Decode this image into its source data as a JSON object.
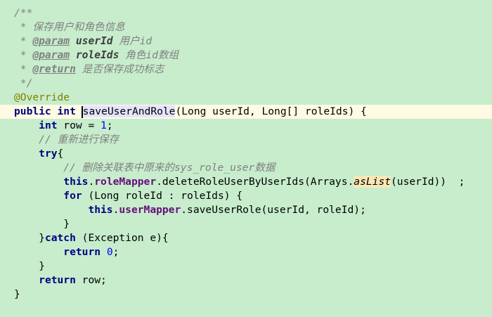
{
  "code": {
    "l1": "/**",
    "l2_prefix": " * ",
    "l2_text": "保存用户和角色信息",
    "l3_prefix": " * ",
    "l3_tag": "@param",
    "l3_name": "userId",
    "l3_desc": " 用户id",
    "l4_prefix": " * ",
    "l4_tag": "@param",
    "l4_name": "roleIds",
    "l4_desc": " 角色id数组",
    "l5_prefix": " * ",
    "l5_tag": "@return",
    "l5_desc": " 是否保存成功标志",
    "l6": " */",
    "l7": "@Override",
    "l8_kw1": "public",
    "l8_kw2": "int",
    "l8_method": "saveUserAndRole",
    "l8_rest": "(Long userId, Long[] roleIds) {",
    "l9_kw": "int",
    "l9_mid": " row = ",
    "l9_num": "1",
    "l9_end": ";",
    "l10_comment": "// 重新进行保存",
    "l11_kw": "try",
    "l11_end": "{",
    "l12_comment": "// 删除关联表中原来的sys_role_user数据",
    "l13_this": "this",
    "l13_dot": ".",
    "l13_field": "roleMapper",
    "l13_call": ".deleteRoleUserByUserIds(Arrays.",
    "l13_static": "asList",
    "l13_end": "(userId))  ;",
    "l14_kw": "for",
    "l14_rest": " (Long roleId : roleIds) {",
    "l15_this": "this",
    "l15_dot": ".",
    "l15_field": "userMapper",
    "l15_call": ".saveUserRole(userId, roleId);",
    "l16": "}",
    "l17_start": "}",
    "l17_kw": "catch",
    "l17_rest": " (Exception e){",
    "l18_kw": "return",
    "l18_num": "0",
    "l18_end": ";",
    "l19": "}",
    "l20_kw": "return",
    "l20_rest": " row;",
    "l21": "}"
  }
}
